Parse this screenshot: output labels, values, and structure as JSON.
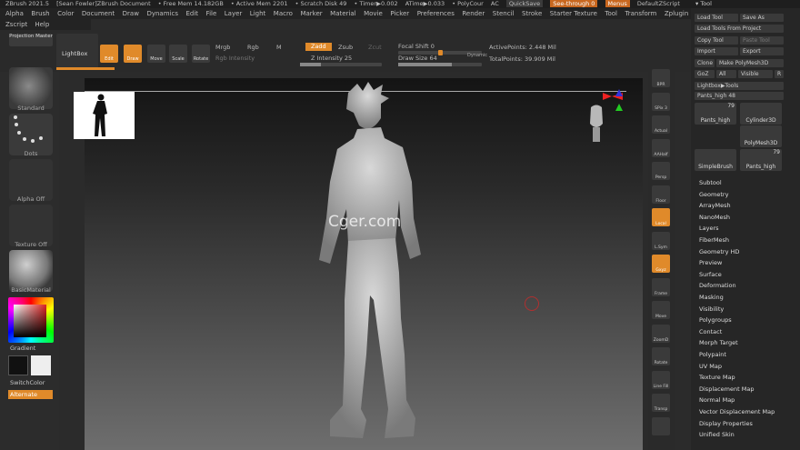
{
  "titlebar": {
    "app": "ZBrush 2021.5",
    "document": "[Sean Fowler]ZBrush Document",
    "free_mem": "• Free Mem 14.182GB",
    "active_mem": "• Active Mem 2201",
    "scratch_disk": "• Scratch Disk 49",
    "timer": "• Timer▶0.002",
    "atime": "ATime▶0.033",
    "polycount": "• PolyCour",
    "ac": "AC",
    "quicksave": "QuickSave",
    "see_through": "See-through  0",
    "menus": "Menus",
    "default_zscript": "DefaultZScript"
  },
  "menubar": [
    "Alpha",
    "Brush",
    "Color",
    "Document",
    "Draw",
    "Dynamics",
    "Edit",
    "File",
    "Layer",
    "Light",
    "Macro",
    "Marker",
    "Material",
    "Movie",
    "Picker",
    "Preferences",
    "Render",
    "Stencil",
    "Stroke",
    "Starter Texture",
    "Tool",
    "Transform",
    "Zplugin"
  ],
  "menubar2": [
    "Zscript",
    "Help"
  ],
  "right_title": "Tool",
  "toolbar": {
    "projection_master": "Projection Master",
    "lightbox": "LightBox",
    "edit": "Edit",
    "draw": "Draw",
    "move": "Move",
    "scale": "Scale",
    "rotate": "Rotate",
    "mrgb": "Mrgb",
    "rgb": "Rgb",
    "m": "M",
    "rgb_intensity": "Rgb Intensity",
    "zadd": "Zadd",
    "zsub": "Zsub",
    "zcut": "Zcut",
    "z_intensity_label": "Z Intensity",
    "z_intensity_value": "25",
    "focal_shift_label": "Focal Shift",
    "focal_shift_value": "0",
    "draw_size_label": "Draw Size",
    "draw_size_value": "64",
    "dynamic": "Dynamic",
    "active_points": "ActivePoints: 2.448 Mil",
    "total_points": "TotalPoints: 39.909 Mil",
    "z_intensity_level": 0.25,
    "draw_size_level": 0.64
  },
  "left_shelf": {
    "standard": "Standard",
    "dots": "Dots",
    "alpha_off": "Alpha Off",
    "texture_off": "Texture Off",
    "material": "BasicMaterial",
    "gradient": "Gradient",
    "switch_color": "SwitchColor",
    "alternate": "Alternate"
  },
  "right_icons": [
    "BPR",
    "SPix 3",
    "Actual",
    "AAHalf",
    "Persp",
    "Floor",
    "Local",
    "L.Sym",
    "Gxyz",
    "Frame",
    "Move",
    "ZoomD",
    "Rotate",
    "Line Fill",
    "Transp",
    ""
  ],
  "rpanel": {
    "load_tool": "Load Tool",
    "save_as": "Save As",
    "load_tools_from_project": "Load Tools From Project",
    "copy_tool": "Copy Tool",
    "paste_tool": "Paste Tool",
    "import": "Import",
    "export": "Export",
    "clone": "Clone",
    "make_polymesh": "Make PolyMesh3D",
    "goz": "GoZ",
    "all": "All",
    "visible": "Visible",
    "r": "R",
    "lightbox_tools": "Lightbox▶Tools",
    "current_tool_label": "Pants_high",
    "current_tool_value": "48",
    "tiles": [
      {
        "name": "Pants_high",
        "count": "79"
      },
      {
        "name": "Cylinder3D",
        "count": ""
      },
      {
        "name": "PolyMesh3D",
        "count": ""
      },
      {
        "name": "SimpleBrush",
        "count": ""
      },
      {
        "name": "Pants_high",
        "count": "79"
      }
    ],
    "subpalettes": [
      "Subtool",
      "Geometry",
      "ArrayMesh",
      "NanoMesh",
      "Layers",
      "FiberMesh",
      "Geometry HD",
      "Preview",
      "Surface",
      "Deformation",
      "Masking",
      "Visibility",
      "Polygroups",
      "Contact",
      "Morph Target",
      "Polypaint",
      "UV Map",
      "Texture Map",
      "Displacement Map",
      "Normal Map",
      "Vector Displacement Map",
      "Display Properties",
      "Unified Skin"
    ]
  },
  "watermark": "Cger.com",
  "colors": {
    "accent": "#e08a2a",
    "background": "#2b2b2b"
  }
}
